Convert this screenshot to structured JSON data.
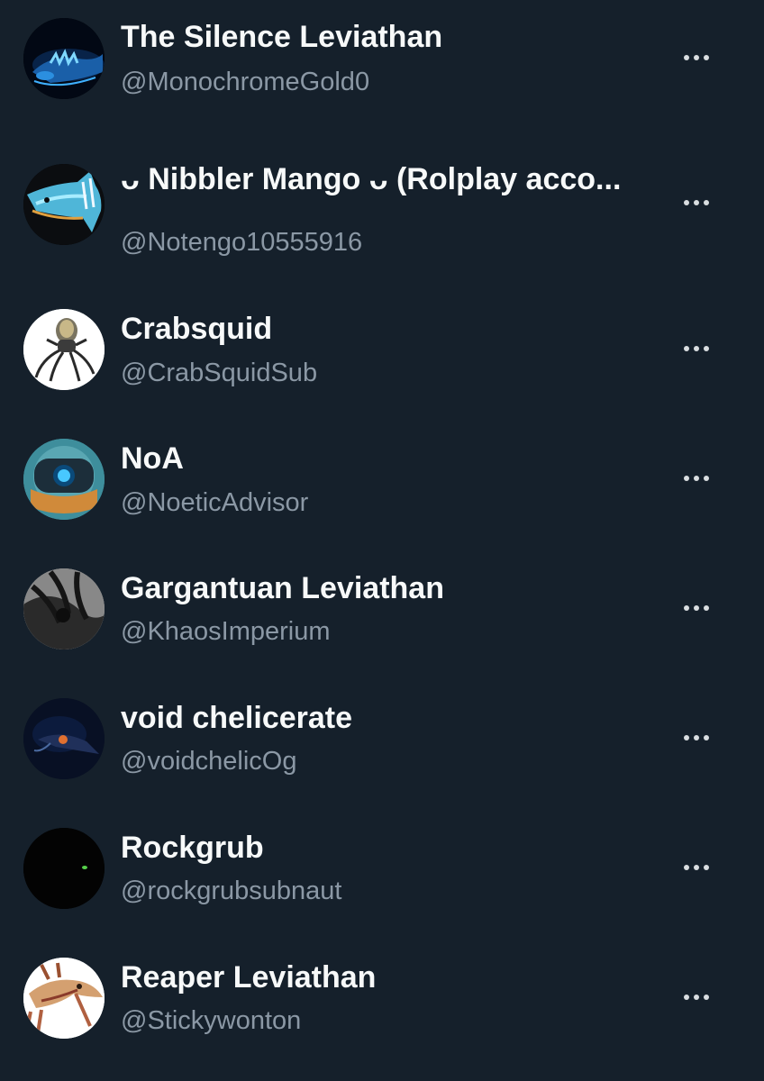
{
  "accounts": [
    {
      "name": "The Silence Leviathan",
      "handle": "@MonochromeGold0",
      "avatar_icon": "silence-leviathan-avatar"
    },
    {
      "name": "ᴗ Nibbler Mango ᴗ (Rolplay acco...",
      "handle": "@Notengo10555916",
      "avatar_icon": "nibbler-mango-avatar"
    },
    {
      "name": "Crabsquid",
      "handle": "@CrabSquidSub",
      "avatar_icon": "crabsquid-avatar"
    },
    {
      "name": "NoA",
      "handle": "@NoeticAdvisor",
      "avatar_icon": "noa-avatar"
    },
    {
      "name": "Gargantuan Leviathan",
      "handle": "@KhaosImperium",
      "avatar_icon": "gargantuan-leviathan-avatar"
    },
    {
      "name": "void chelicerate",
      "handle": "@voidchelicOg",
      "avatar_icon": "void-chelicerate-avatar"
    },
    {
      "name": "Rockgrub",
      "handle": "@rockgrubsubnaut",
      "avatar_icon": "rockgrub-avatar"
    },
    {
      "name": "Reaper Leviathan",
      "handle": "@Stickywonton",
      "avatar_icon": "reaper-leviathan-avatar"
    }
  ],
  "colors": {
    "background": "#15202b",
    "name": "#f7f9f9",
    "handle": "#8b98a5",
    "more_dots": "#d9dde0"
  }
}
